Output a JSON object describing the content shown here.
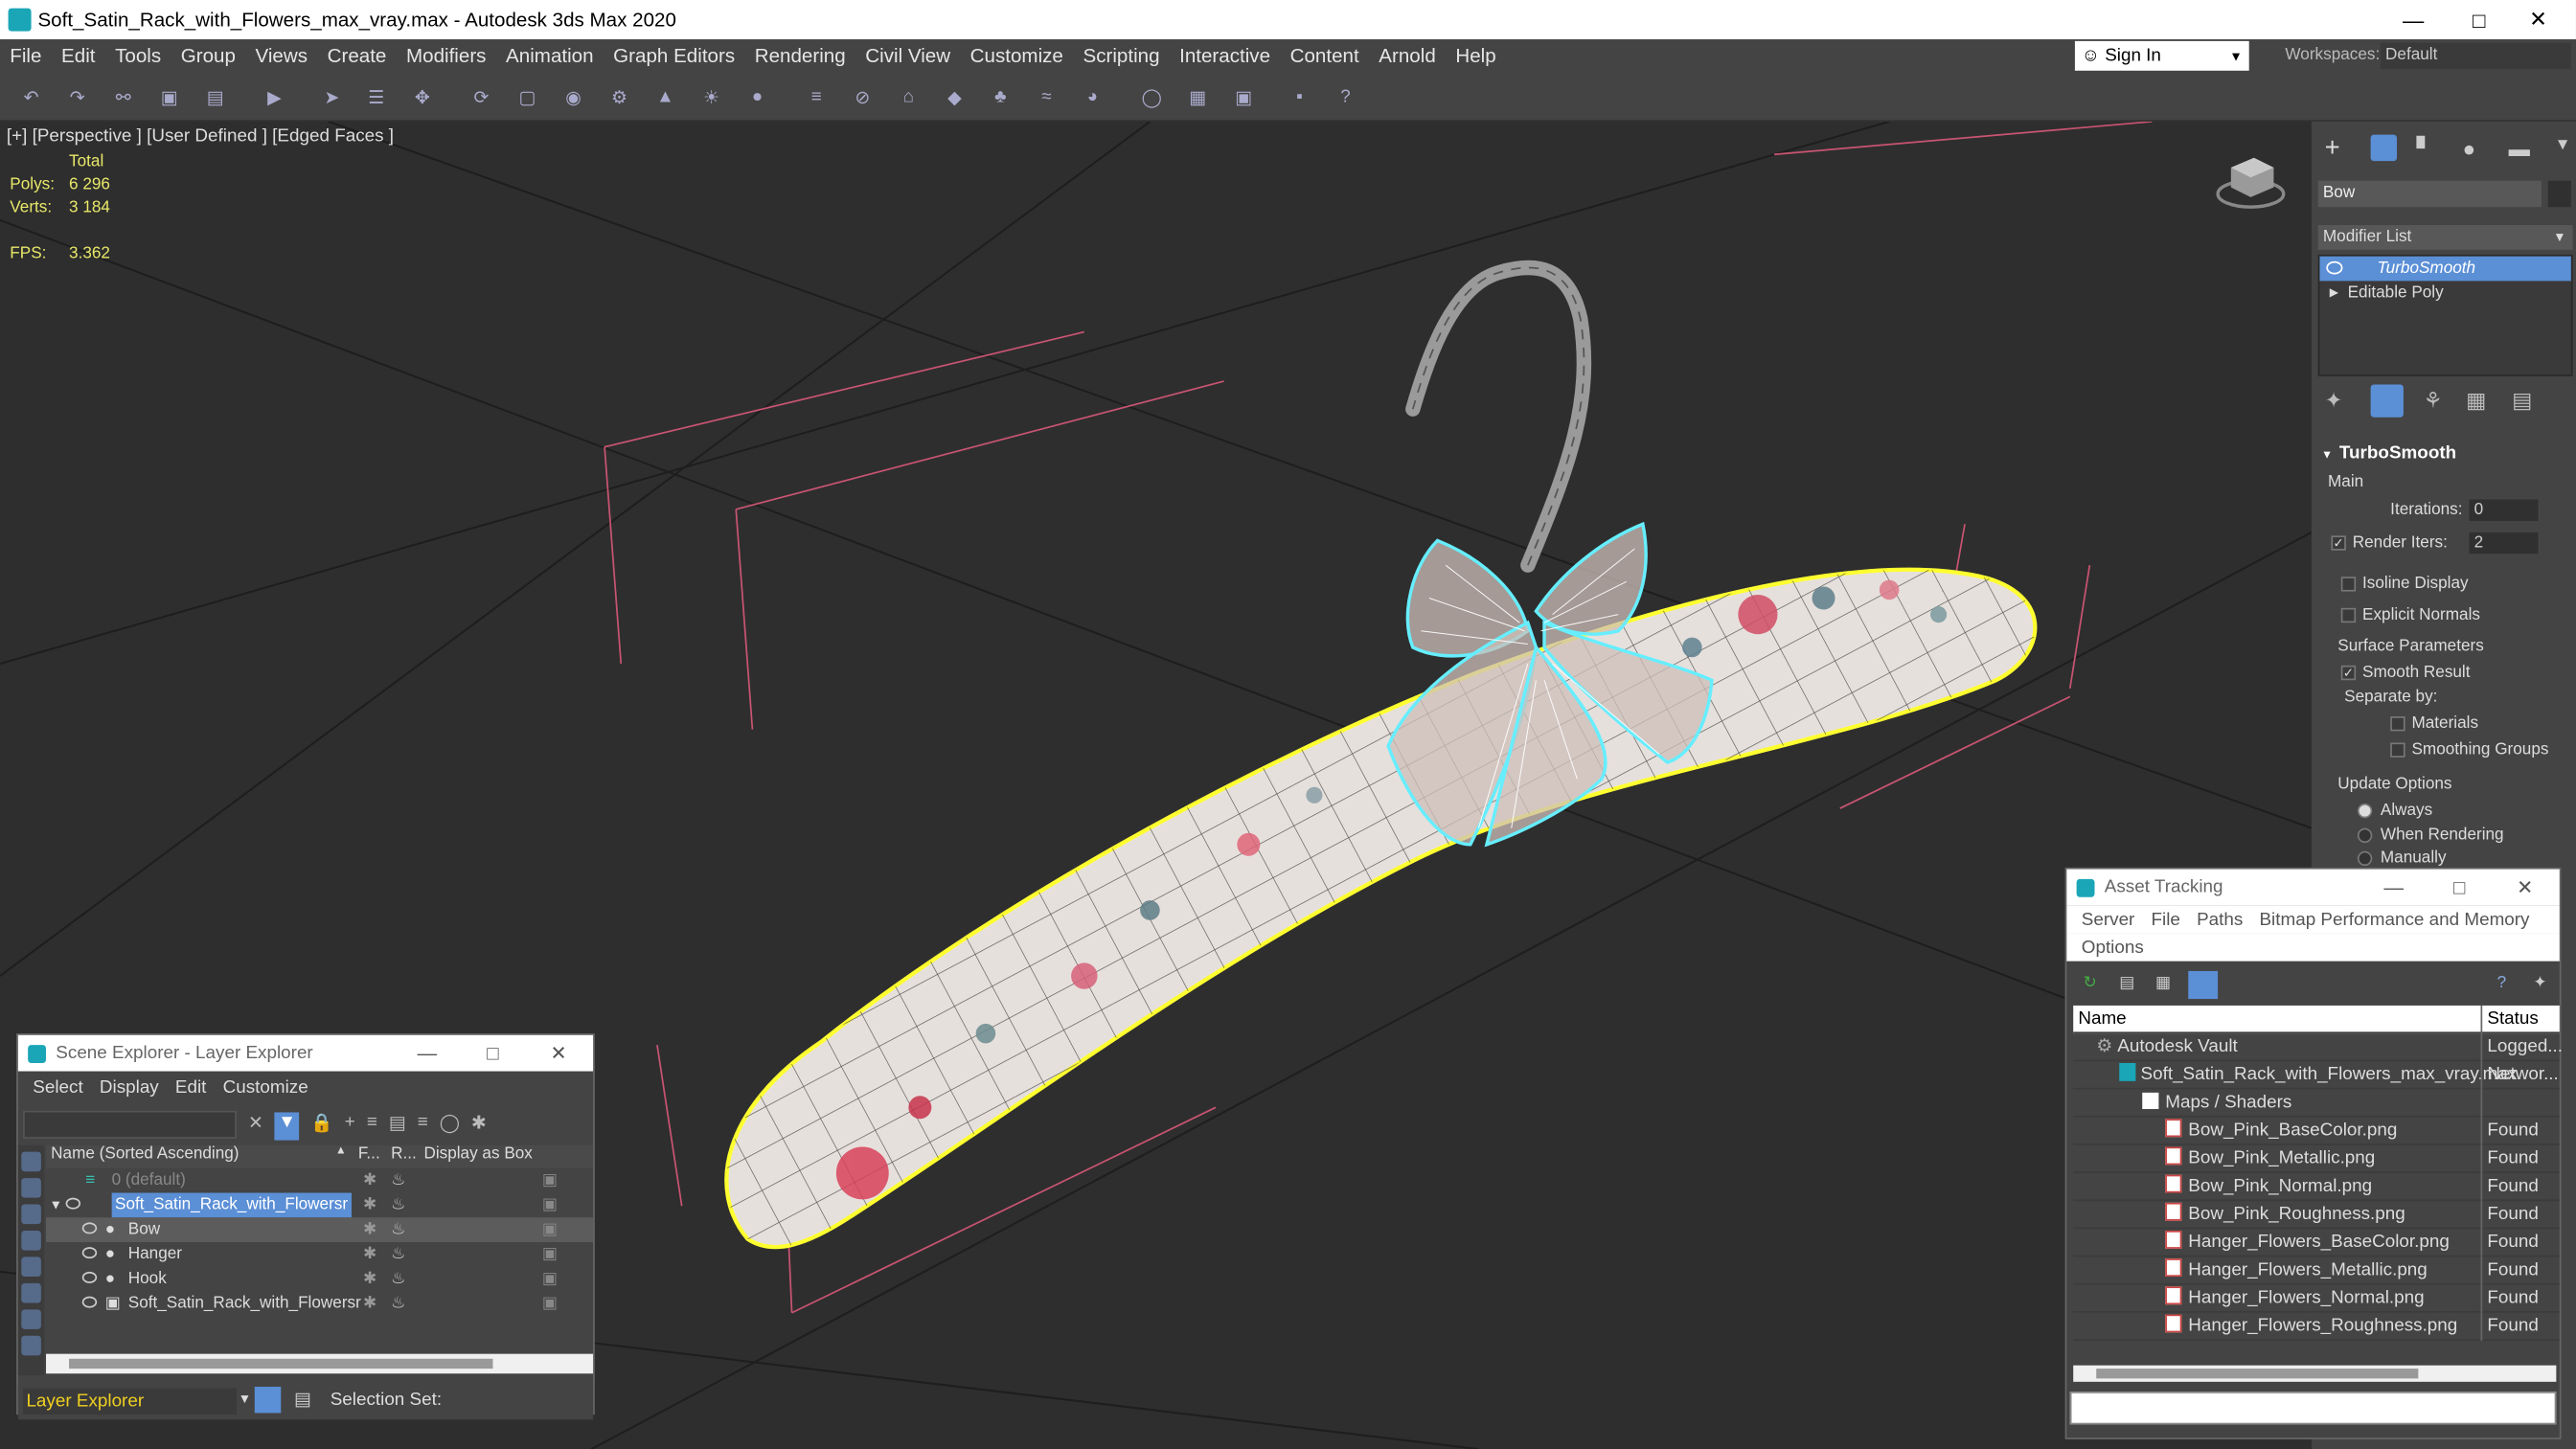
{
  "window": {
    "title": "Soft_Satin_Rack_with_Flowers_max_vray.max - Autodesk 3ds Max 2020"
  },
  "menu": [
    "File",
    "Edit",
    "Tools",
    "Group",
    "Views",
    "Create",
    "Modifiers",
    "Animation",
    "Graph Editors",
    "Rendering",
    "Civil View",
    "Customize",
    "Scripting",
    "Interactive",
    "Content",
    "Arnold",
    "Help"
  ],
  "account": {
    "sign_in": "Sign In",
    "workspaces_label": "Workspaces:",
    "workspace": "Default"
  },
  "viewport": {
    "label": "[+] [Perspective ] [User Defined ] [Edged Faces ]",
    "stats": {
      "total_label": "Total",
      "polys_label": "Polys:",
      "polys": "6 296",
      "verts_label": "Verts:",
      "verts": "3 184",
      "fps_label": "FPS:",
      "fps": "3.362"
    }
  },
  "command_panel": {
    "object_name": "Bow",
    "modifier_list": "Modifier List",
    "stack": [
      "TurboSmooth",
      "Editable Poly"
    ],
    "rollout_title": "TurboSmooth",
    "main_label": "Main",
    "iterations_label": "Iterations:",
    "iterations": "0",
    "render_iters_label": "Render Iters:",
    "render_iters": "2",
    "isoline": "Isoline Display",
    "explicit_normals": "Explicit Normals",
    "surface_params": "Surface Parameters",
    "smooth_result": "Smooth Result",
    "separate_by": "Separate by:",
    "materials": "Materials",
    "smoothing_groups": "Smoothing Groups",
    "update_options": "Update Options",
    "always": "Always",
    "when_rendering": "When Rendering",
    "manually": "Manually"
  },
  "scene_explorer": {
    "title": "Scene Explorer - Layer Explorer",
    "menu": [
      "Select",
      "Display",
      "Edit",
      "Customize"
    ],
    "columns": {
      "name": "Name (Sorted Ascending)",
      "f": "F...",
      "r": "R...",
      "display": "Display as Box"
    },
    "rows": [
      {
        "label": "0 (default)"
      },
      {
        "label": "Soft_Satin_Rack_with_Flowersr"
      },
      {
        "label": "Bow"
      },
      {
        "label": "Hanger"
      },
      {
        "label": "Hook"
      },
      {
        "label": "Soft_Satin_Rack_with_Flowersr"
      }
    ],
    "footer_dropdown": "Layer Explorer",
    "selection_set": "Selection Set:"
  },
  "asset_tracking": {
    "title": "Asset Tracking",
    "menu": [
      "Server",
      "File",
      "Paths",
      "Bitmap Performance and Memory"
    ],
    "menu2": "Options",
    "columns": {
      "name": "Name",
      "status": "Status"
    },
    "rows": [
      {
        "name": "Autodesk Vault",
        "status": "Logged..."
      },
      {
        "name": "Soft_Satin_Rack_with_Flowers_max_vray.max",
        "status": "Networ..."
      },
      {
        "name": "Maps / Shaders",
        "status": ""
      },
      {
        "name": "Bow_Pink_BaseColor.png",
        "status": "Found"
      },
      {
        "name": "Bow_Pink_Metallic.png",
        "status": "Found"
      },
      {
        "name": "Bow_Pink_Normal.png",
        "status": "Found"
      },
      {
        "name": "Bow_Pink_Roughness.png",
        "status": "Found"
      },
      {
        "name": "Hanger_Flowers_BaseColor.png",
        "status": "Found"
      },
      {
        "name": "Hanger_Flowers_Metallic.png",
        "status": "Found"
      },
      {
        "name": "Hanger_Flowers_Normal.png",
        "status": "Found"
      },
      {
        "name": "Hanger_Flowers_Roughness.png",
        "status": "Found"
      }
    ]
  },
  "colors": {
    "accent": "#5b8fd6",
    "selection_yellow": "#f0f000",
    "bow_cyan": "#5fe8ff",
    "grid_line": "#1d1d1d",
    "bbox_pink": "#d05a78"
  }
}
